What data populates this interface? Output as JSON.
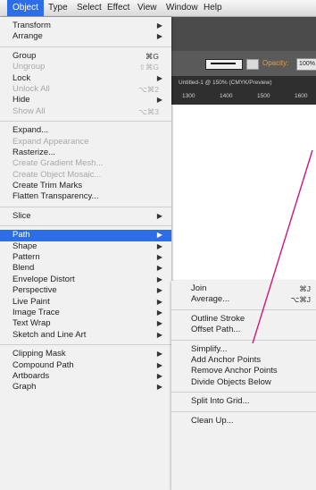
{
  "menubar": {
    "items": [
      "Object",
      "Type",
      "Select",
      "Effect",
      "View",
      "Window",
      "Help"
    ],
    "active": "Object"
  },
  "app": {
    "opacity_label": "Opacity:",
    "opacity_value": "100%",
    "doc_title": "Untitled-1 @ 150% (CMYK/Preview)",
    "ruler": [
      "1300",
      "1400",
      "1500",
      "1600"
    ]
  },
  "object_menu": {
    "items": [
      {
        "label": "Transform",
        "submenu": true,
        "enabled": true
      },
      {
        "label": "Arrange",
        "submenu": true,
        "enabled": true
      },
      {
        "sep": true
      },
      {
        "label": "Group",
        "shortcut": "⌘G",
        "enabled": true
      },
      {
        "label": "Ungroup",
        "shortcut": "⇧⌘G",
        "enabled": false
      },
      {
        "label": "Lock",
        "submenu": true,
        "enabled": true
      },
      {
        "label": "Unlock All",
        "shortcut": "⌥⌘2",
        "enabled": false
      },
      {
        "label": "Hide",
        "submenu": true,
        "enabled": true
      },
      {
        "label": "Show All",
        "shortcut": "⌥⌘3",
        "enabled": false
      },
      {
        "sep": true
      },
      {
        "label": "Expand...",
        "enabled": true
      },
      {
        "label": "Expand Appearance",
        "enabled": false
      },
      {
        "label": "Rasterize...",
        "enabled": true
      },
      {
        "label": "Create Gradient Mesh...",
        "enabled": false
      },
      {
        "label": "Create Object Mosaic...",
        "enabled": false
      },
      {
        "label": "Create Trim Marks",
        "enabled": true
      },
      {
        "label": "Flatten Transparency...",
        "enabled": true
      },
      {
        "sep": true
      },
      {
        "label": "Slice",
        "submenu": true,
        "enabled": true
      },
      {
        "sep": true
      },
      {
        "label": "Path",
        "submenu": true,
        "enabled": true,
        "highlighted": true
      },
      {
        "label": "Shape",
        "submenu": true,
        "enabled": true
      },
      {
        "label": "Pattern",
        "submenu": true,
        "enabled": true
      },
      {
        "label": "Blend",
        "submenu": true,
        "enabled": true
      },
      {
        "label": "Envelope Distort",
        "submenu": true,
        "enabled": true
      },
      {
        "label": "Perspective",
        "submenu": true,
        "enabled": true
      },
      {
        "label": "Live Paint",
        "submenu": true,
        "enabled": true
      },
      {
        "label": "Image Trace",
        "submenu": true,
        "enabled": true
      },
      {
        "label": "Text Wrap",
        "submenu": true,
        "enabled": true
      },
      {
        "label": "Sketch and Line Art",
        "submenu": true,
        "enabled": true
      },
      {
        "sep": true
      },
      {
        "label": "Clipping Mask",
        "submenu": true,
        "enabled": true
      },
      {
        "label": "Compound Path",
        "submenu": true,
        "enabled": true
      },
      {
        "label": "Artboards",
        "submenu": true,
        "enabled": true
      },
      {
        "label": "Graph",
        "submenu": true,
        "enabled": true
      }
    ]
  },
  "path_submenu": {
    "items": [
      {
        "label": "Join",
        "shortcut": "⌘J"
      },
      {
        "label": "Average...",
        "shortcut": "⌥⌘J"
      },
      {
        "sep": true
      },
      {
        "label": "Outline Stroke"
      },
      {
        "label": "Offset Path..."
      },
      {
        "sep": true
      },
      {
        "label": "Simplify..."
      },
      {
        "label": "Add Anchor Points"
      },
      {
        "label": "Remove Anchor Points"
      },
      {
        "label": "Divide Objects Below"
      },
      {
        "sep": true
      },
      {
        "label": "Split Into Grid..."
      },
      {
        "sep": true
      },
      {
        "label": "Clean Up..."
      }
    ]
  },
  "colors": {
    "highlight": "#2d6ee6",
    "annotation": "#d4147a"
  }
}
